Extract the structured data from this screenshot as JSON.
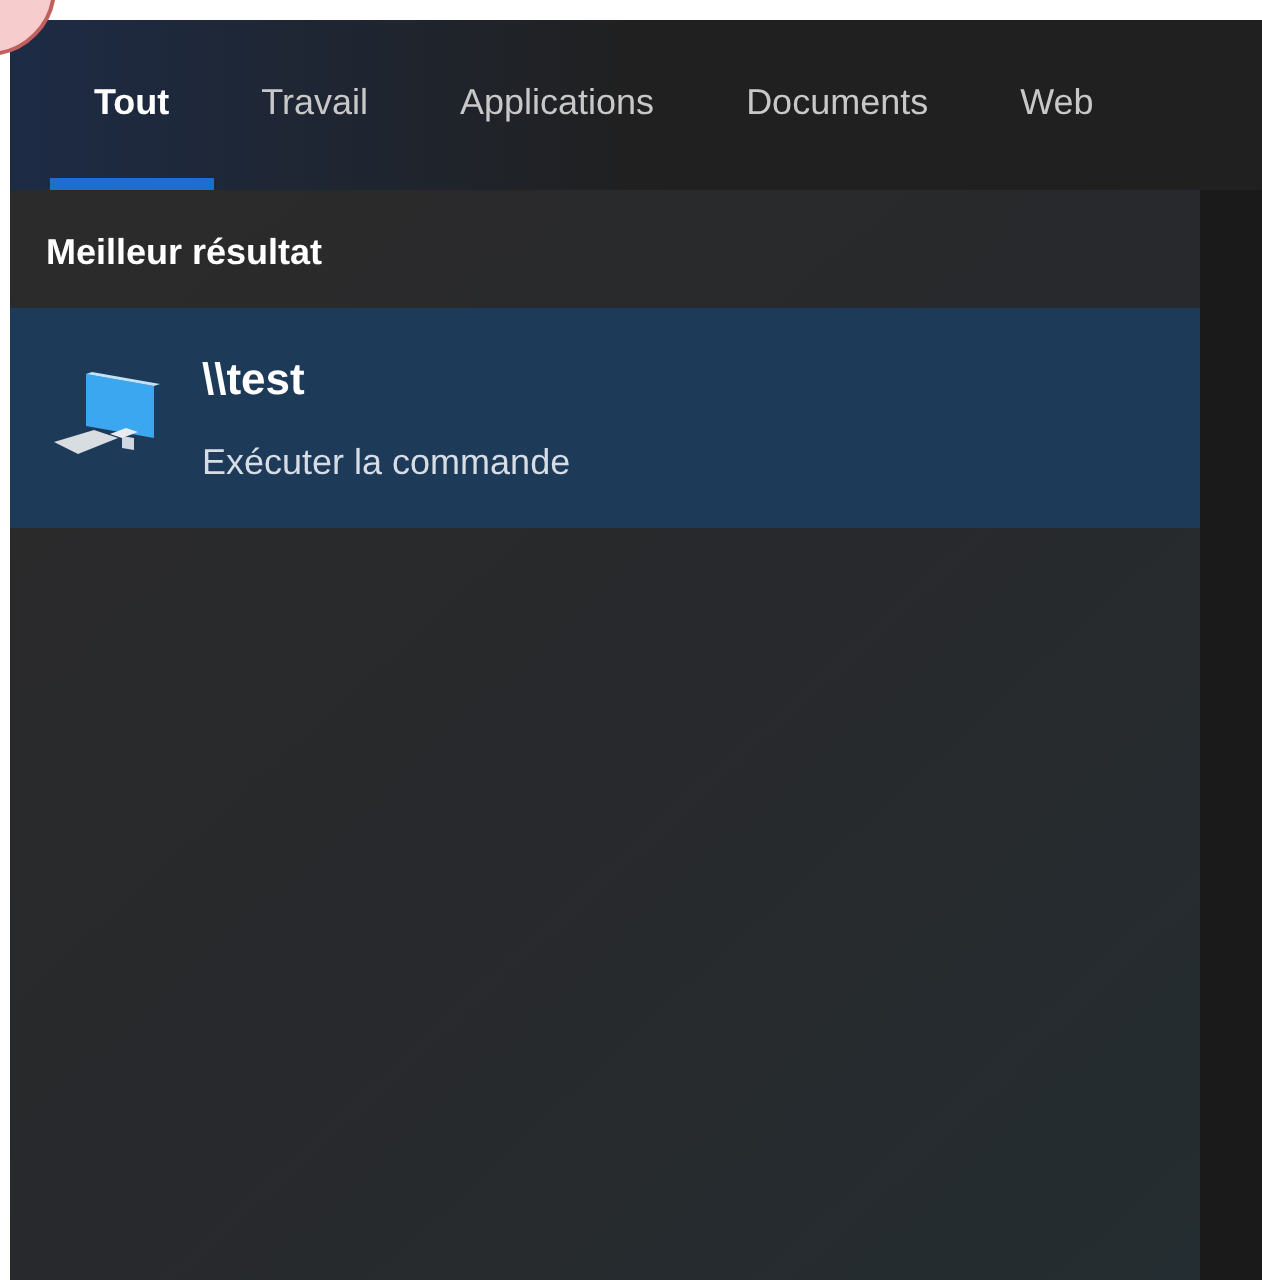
{
  "tabs": [
    {
      "label": "Tout",
      "selected": true
    },
    {
      "label": "Travail",
      "selected": false
    },
    {
      "label": "Applications",
      "selected": false
    },
    {
      "label": "Documents",
      "selected": false
    },
    {
      "label": "Web",
      "selected": false
    }
  ],
  "best_match": {
    "heading": "Meilleur résultat",
    "result": {
      "title": "\\\\test",
      "subtitle": "Exécuter la commande",
      "selected": true
    }
  }
}
